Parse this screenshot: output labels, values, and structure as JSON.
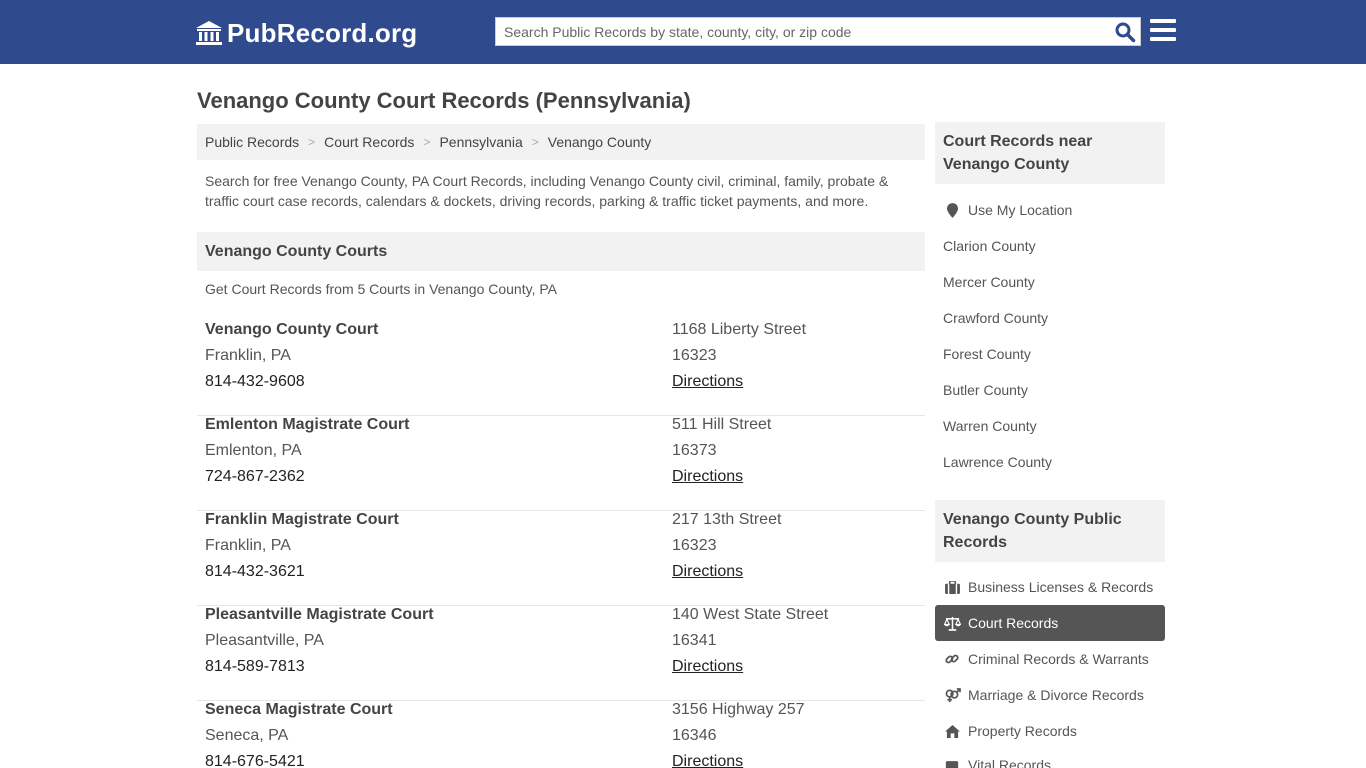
{
  "header": {
    "logo_text": "PubRecord.org",
    "search_placeholder": "Search Public Records by state, county, city, or zip code"
  },
  "page_title": "Venango County Court Records (Pennsylvania)",
  "breadcrumb": [
    "Public Records",
    "Court Records",
    "Pennsylvania",
    "Venango County"
  ],
  "intro": "Search for free Venango County, PA Court Records, including Venango County civil, criminal, family, probate & traffic court case records, calendars & dockets, driving records, parking & traffic ticket payments, and more.",
  "courts_section": {
    "title": "Venango County Courts",
    "subtitle": "Get Court Records from 5 Courts in Venango County, PA",
    "directions_label": "Directions",
    "items": [
      {
        "name": "Venango County Court",
        "city": "Franklin, PA",
        "phone": "814-432-9608",
        "address": "1168 Liberty Street",
        "zip": "16323"
      },
      {
        "name": "Emlenton Magistrate Court",
        "city": "Emlenton, PA",
        "phone": "724-867-2362",
        "address": "511 Hill Street",
        "zip": "16373"
      },
      {
        "name": "Franklin Magistrate Court",
        "city": "Franklin, PA",
        "phone": "814-432-3621",
        "address": "217 13th Street",
        "zip": "16323"
      },
      {
        "name": "Pleasantville Magistrate Court",
        "city": "Pleasantville, PA",
        "phone": "814-589-7813",
        "address": "140 West State Street",
        "zip": "16341"
      },
      {
        "name": "Seneca Magistrate Court",
        "city": "Seneca, PA",
        "phone": "814-676-5421",
        "address": "3156 Highway 257",
        "zip": "16346"
      }
    ]
  },
  "sidebar": {
    "nearby_title": "Court Records near Venango County",
    "use_location": "Use My Location",
    "nearby": [
      "Clarion County",
      "Mercer County",
      "Crawford County",
      "Forest County",
      "Butler County",
      "Warren County",
      "Lawrence County"
    ],
    "public_title": "Venango County Public Records",
    "public_links": [
      {
        "label": "Business Licenses & Records",
        "icon": "briefcase-icon"
      },
      {
        "label": "Court Records",
        "icon": "scales-icon",
        "active": true
      },
      {
        "label": "Criminal Records & Warrants",
        "icon": "link-icon"
      },
      {
        "label": "Marriage & Divorce Records",
        "icon": "venus-mars-icon"
      },
      {
        "label": "Property Records",
        "icon": "home-icon"
      },
      {
        "label": "Vital Records",
        "icon": "vital-icon"
      }
    ]
  },
  "colors": {
    "header_bg": "#2f4b8e",
    "panel_bg": "#f2f2f2",
    "active_bg": "#555555",
    "search_icon": "#2f4b8e"
  }
}
